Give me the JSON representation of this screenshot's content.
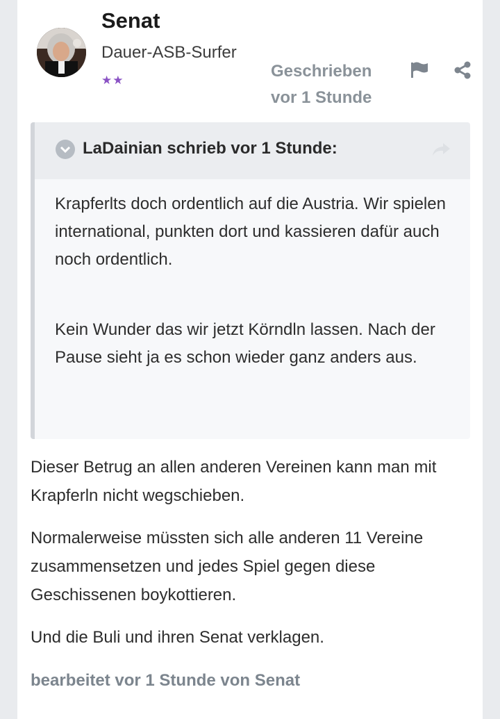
{
  "post": {
    "author": "Senat",
    "rank": "Dauer-ASB-Surfer",
    "stars": "★★",
    "date_line1": "Geschrieben",
    "date_line2": "vor 1 Stunde",
    "icons": {
      "report": "flag-icon",
      "share": "share-icon"
    }
  },
  "quote": {
    "citation": "LaDainian schrieb vor 1 Stunde:",
    "icons": {
      "toggle": "chevron-down-icon",
      "goto": "share-arrow-icon"
    },
    "paragraphs": [
      "Krapferlts doch ordentlich auf die Austria. Wir spielen international, punkten dort und kassieren dafür auch noch ordentlich.",
      "Kein Wunder das wir jetzt Körndln lassen. Nach der Pause sieht ja es schon wieder ganz anders aus."
    ]
  },
  "content": {
    "paragraphs": [
      "Dieser Betrug an allen anderen Vereinen kann man mit Krapferln nicht wegschieben.",
      "Normalerweise müssten sich alle anderen 11 Vereine zusammensetzen und jedes Spiel gegen diese Geschissenen boykottieren.",
      "Und die Buli und ihren Senat verklagen."
    ],
    "edited": "bearbeitet vor 1 Stunde von Senat"
  },
  "colors": {
    "accent_muted": "#8a9299",
    "stars": "#8a52c4",
    "quote_bg": "#f7f8fa"
  }
}
